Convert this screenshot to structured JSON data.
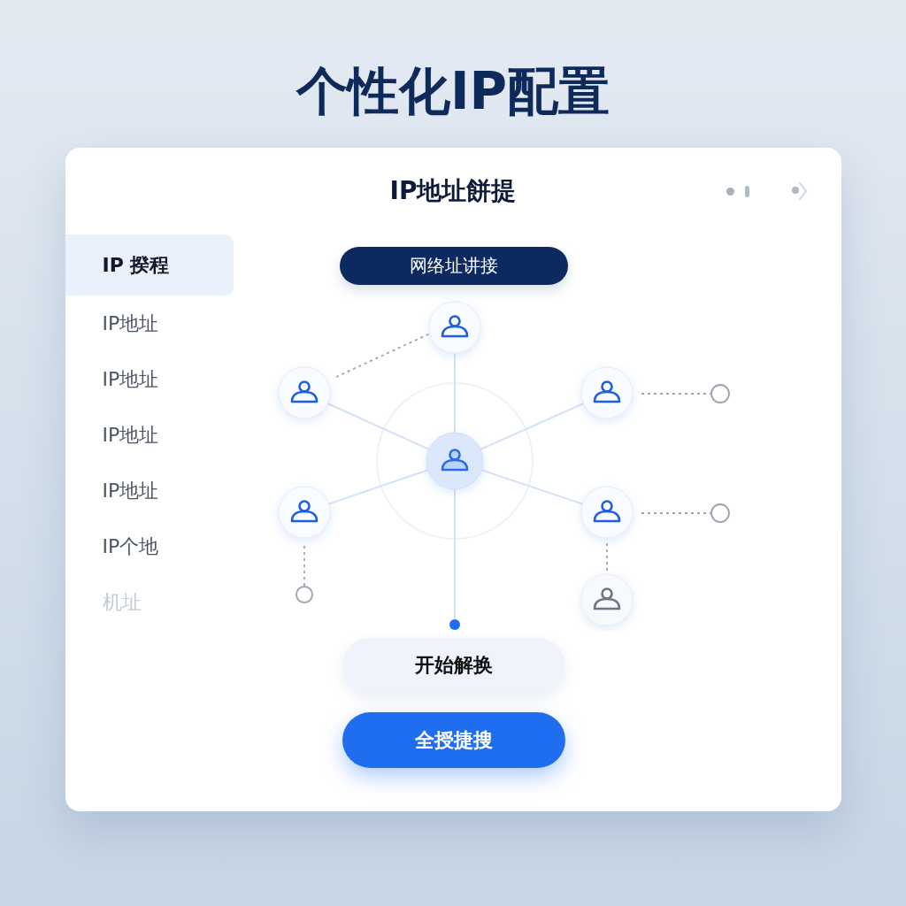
{
  "heading": "个性化IP配置",
  "window": {
    "title": "IP地址餅提"
  },
  "sidebar": {
    "items": [
      {
        "label": "IP 揆程",
        "selected": true,
        "disabled": false
      },
      {
        "label": "IP地址",
        "selected": false,
        "disabled": false
      },
      {
        "label": "IP地址",
        "selected": false,
        "disabled": false
      },
      {
        "label": "IP地址",
        "selected": false,
        "disabled": false
      },
      {
        "label": "IP地址",
        "selected": false,
        "disabled": false
      },
      {
        "label": "IP个地",
        "selected": false,
        "disabled": false
      },
      {
        "label": "机址",
        "selected": false,
        "disabled": true
      }
    ]
  },
  "chip": "网络址讲接",
  "network": {
    "nodes": [
      {
        "kind": "hub"
      },
      {
        "kind": "user"
      },
      {
        "kind": "user"
      },
      {
        "kind": "user"
      },
      {
        "kind": "user"
      },
      {
        "kind": "user"
      },
      {
        "kind": "inactive"
      }
    ]
  },
  "buttons": [
    {
      "label": "开始解换",
      "kind": "secondary"
    },
    {
      "label": "全授捷搜",
      "kind": "primary"
    }
  ]
}
